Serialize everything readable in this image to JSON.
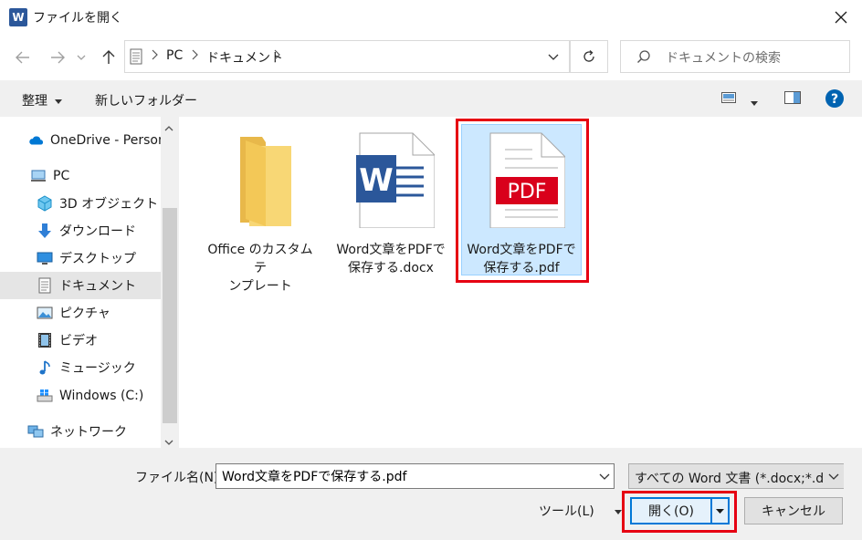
{
  "window": {
    "app_icon_letter": "W",
    "title": "ファイルを開く"
  },
  "address": {
    "segments": [
      "PC",
      "ドキュメント"
    ]
  },
  "search": {
    "placeholder": "ドキュメントの検索"
  },
  "toolbar": {
    "organize_label": "整理",
    "new_folder_label": "新しいフォルダー"
  },
  "sidebar": {
    "items": [
      {
        "label": "OneDrive - Person",
        "icon": "onedrive-icon"
      },
      {
        "label": "PC",
        "icon": "pc-icon"
      },
      {
        "label": "3D オブジェクト",
        "icon": "3d-objects-icon"
      },
      {
        "label": "ダウンロード",
        "icon": "download-icon"
      },
      {
        "label": "デスクトップ",
        "icon": "desktop-icon"
      },
      {
        "label": "ドキュメント",
        "icon": "documents-icon"
      },
      {
        "label": "ピクチャ",
        "icon": "pictures-icon"
      },
      {
        "label": "ビデオ",
        "icon": "video-icon"
      },
      {
        "label": "ミュージック",
        "icon": "music-icon"
      },
      {
        "label": "Windows (C:)",
        "icon": "drive-icon"
      },
      {
        "label": "ネットワーク",
        "icon": "network-icon"
      }
    ]
  },
  "files": [
    {
      "line1": "Office のカスタム テ",
      "line2": "ンプレート",
      "icon": "folder-icon"
    },
    {
      "line1": "Word文章をPDFで",
      "line2": "保存する.docx",
      "icon": "word-doc-icon"
    },
    {
      "line1": "Word文章をPDFで",
      "line2": "保存する.pdf",
      "icon": "pdf-icon",
      "pdf_badge": "PDF"
    }
  ],
  "bottom": {
    "filename_label": "ファイル名(N):",
    "filename_value": "Word文章をPDFで保存する.pdf",
    "filetype_value": "すべての Word 文書 (*.docx;*.doc",
    "tools_label": "ツール(L)",
    "open_label": "開く(O)",
    "cancel_label": "キャンセル"
  },
  "colors": {
    "highlight": "#e60012",
    "accent": "#0078d7",
    "selection": "#cce8ff",
    "word_blue": "#2b579a",
    "pdf_red": "#d9001b"
  }
}
